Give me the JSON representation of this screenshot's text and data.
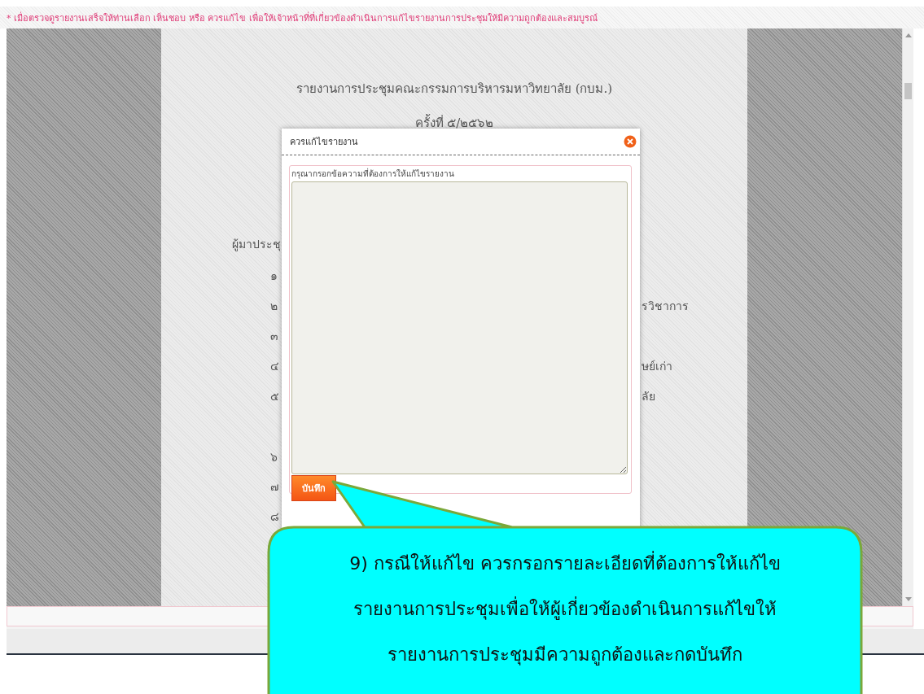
{
  "notice": "* เมื่อตรวจดูรายงานเสร็จให้ท่านเลือก เห็นชอบ หรือ ควรแก้ไข เพื่อให้เจ้าหน้าที่ที่เกี่ยวข้องดำเนินการแก้ไขรายงานการประชุมให้มีความถูกต้องและสมบูรณ์",
  "document": {
    "title": "รายงานการประชุมคณะกรรมการบริหารมหาวิทยาลัย (กบม.)",
    "session": "ครั้งที่ ๕/๒๕๖๒",
    "section_heading": "ผู้มาประชุ",
    "items": [
      {
        "number": "๑"
      },
      {
        "number": "๒",
        "tail": "รวิชาการ"
      },
      {
        "number": "๓"
      },
      {
        "number": "๔",
        "tail": "ษย์เก่า"
      },
      {
        "number": "๕",
        "tail": "ลัย"
      }
    ],
    "more_items": [
      {
        "number": "๖"
      },
      {
        "number": "๗"
      },
      {
        "number": "๘"
      }
    ]
  },
  "dialog": {
    "title": "ควรแก้ไขรายงาน",
    "field_label": "กรุณากรอกข้อความที่ต้องการให้แก้ไขรายงาน",
    "save_button": "บันทึก"
  },
  "callout": {
    "lines": [
      "9) กรณีให้แก้ไข ควรกรอกรายละเอียดที่ต้องการให้แก้ไข",
      "รายงานการประชุมเพื่อให้ผู้เกี่ยวข้องดำเนินการแก้ไขให้",
      "รายงานการประชุมมีความถูกต้องและกดบันทึก"
    ]
  }
}
